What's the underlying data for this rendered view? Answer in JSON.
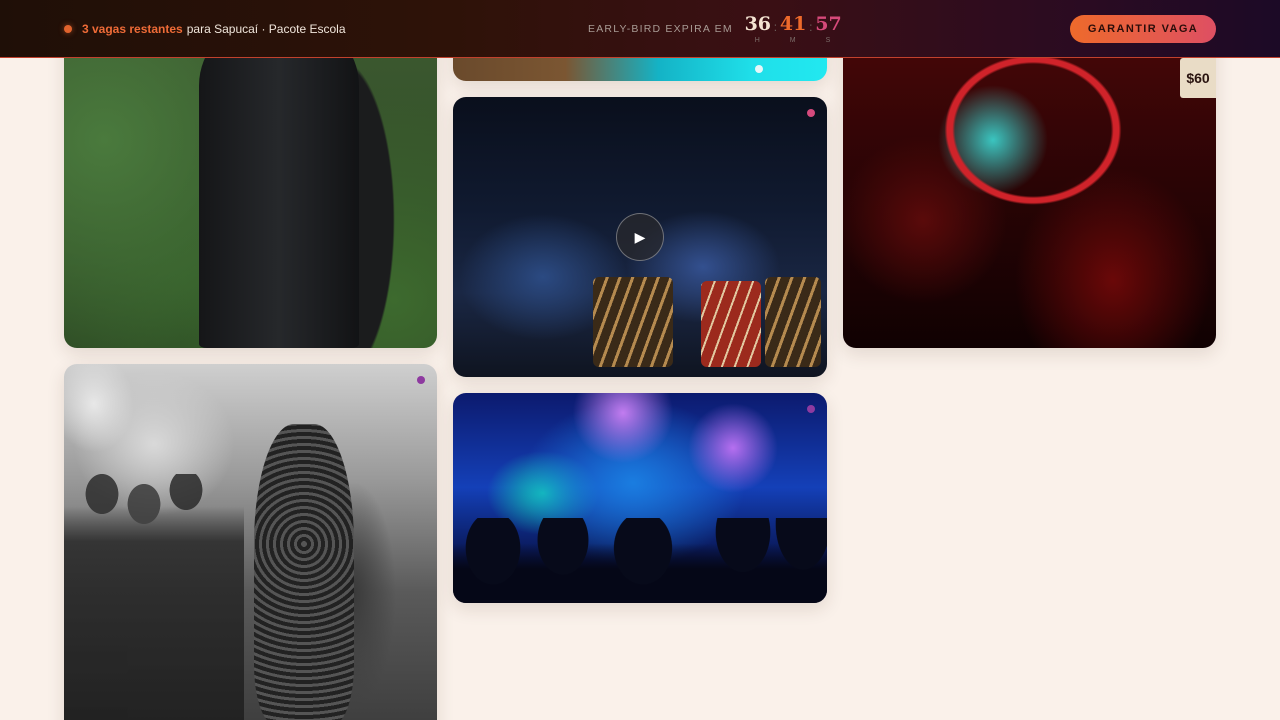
{
  "topbar": {
    "urgency_highlight": "3 vagas restantes",
    "urgency_rest": "para Sapucaí · Pacote Escola",
    "countdown_label": "EARLY-BIRD EXPIRA EM",
    "countdown": [
      {
        "value": "36",
        "unit": "H",
        "color": "#f4e3d2"
      },
      {
        "value": "41",
        "unit": "M",
        "color": "#ee6a2b"
      },
      {
        "value": "57",
        "unit": "S",
        "color": "#d6497a"
      }
    ],
    "separator": ":",
    "cta_label": "GARANTIR VAGA"
  },
  "gallery": {
    "accent_dots": [
      "#d54a7d",
      "#8e3aa0"
    ],
    "sign_text": "$60",
    "play_glyph": "▶"
  }
}
